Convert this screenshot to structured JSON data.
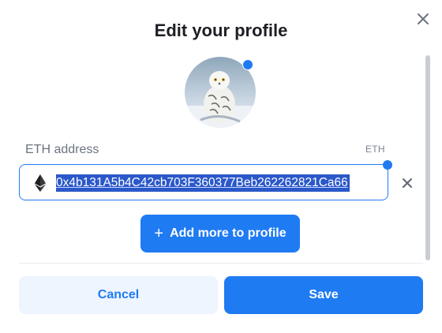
{
  "modal": {
    "title": "Edit your profile",
    "close_icon": "close-icon"
  },
  "avatar": {
    "icon": "snowy-owl-avatar"
  },
  "field": {
    "label": "ETH address",
    "tag": "ETH",
    "value": "0x4b131A5b4C42cb703F360377Beb262262821Ca66",
    "icon": "ethereum-icon",
    "remove_icon": "close-icon"
  },
  "actions": {
    "add_more_label": "Add more to profile",
    "add_icon": "plus-icon",
    "cancel_label": "Cancel",
    "save_label": "Save"
  },
  "colors": {
    "accent": "#1f7bf2",
    "selection": "#2b58c9",
    "cancel_bg": "#eef5fe"
  }
}
